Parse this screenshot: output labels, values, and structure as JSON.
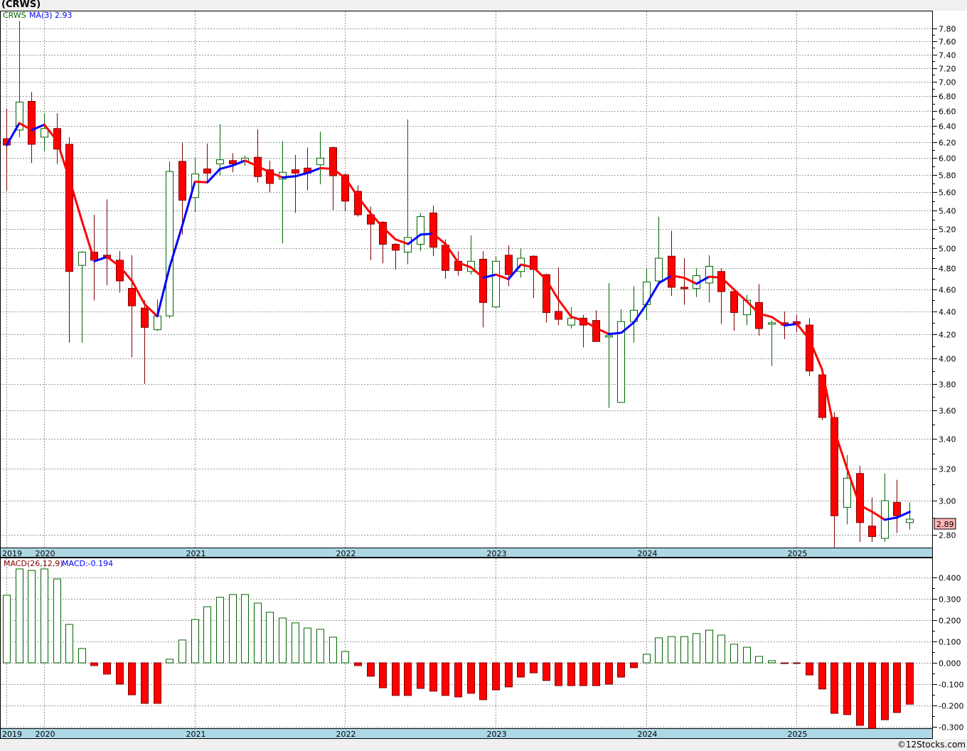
{
  "title": "(CRWS)",
  "copyright": "©12Stocks.com",
  "colors": {
    "up_border": "#006400",
    "down_fill": "#ff0000",
    "down_border": "#800000",
    "ma_up": "#0000ff",
    "ma_down": "#ff0000",
    "date_strip": "#add8e6",
    "last_price_box": "#ffb6b6"
  },
  "price_panel": {
    "legend_symbol": "CRWS",
    "legend_ma": "MA(3)",
    "legend_ma_value": "2.93",
    "last_price": "2.89",
    "scale": "log",
    "y_ticks": [
      "7.80",
      "7.60",
      "7.40",
      "7.20",
      "7.00",
      "6.80",
      "6.60",
      "6.40",
      "6.20",
      "6.00",
      "5.80",
      "5.60",
      "5.40",
      "5.20",
      "5.00",
      "4.80",
      "4.60",
      "4.40",
      "4.20",
      "4.00",
      "3.80",
      "3.60",
      "3.40",
      "3.20",
      "3.00",
      "2.80"
    ]
  },
  "macd_panel": {
    "legend_name": "MACD(26,12,9)",
    "legend_value": "MACD:-0.194",
    "y_ticks": [
      "0.400",
      "0.300",
      "0.200",
      "0.100",
      "0.000",
      "-0.100",
      "-0.200",
      "-0.300"
    ]
  },
  "year_labels": [
    {
      "label": "2019",
      "month": "2019-10"
    },
    {
      "label": "2020",
      "month": "2020-01"
    },
    {
      "label": "2021",
      "month": "2021-01"
    },
    {
      "label": "2022",
      "month": "2022-01"
    },
    {
      "label": "2023",
      "month": "2023-01"
    },
    {
      "label": "2024",
      "month": "2024-01"
    },
    {
      "label": "2025",
      "month": "2025-01"
    }
  ],
  "chart_data": {
    "type": "candlestick",
    "interval": "monthly",
    "grid": true,
    "months": [
      "2019-10",
      "2019-11",
      "2019-12",
      "2020-01",
      "2020-02",
      "2020-03",
      "2020-04",
      "2020-05",
      "2020-06",
      "2020-07",
      "2020-08",
      "2020-09",
      "2020-10",
      "2020-11",
      "2020-12",
      "2021-01",
      "2021-02",
      "2021-03",
      "2021-04",
      "2021-05",
      "2021-06",
      "2021-07",
      "2021-08",
      "2021-09",
      "2021-10",
      "2021-11",
      "2021-12",
      "2022-01",
      "2022-02",
      "2022-03",
      "2022-04",
      "2022-05",
      "2022-06",
      "2022-07",
      "2022-08",
      "2022-09",
      "2022-10",
      "2022-11",
      "2022-12",
      "2023-01",
      "2023-02",
      "2023-03",
      "2023-04",
      "2023-05",
      "2023-06",
      "2023-07",
      "2023-08",
      "2023-09",
      "2023-10",
      "2023-11",
      "2023-12",
      "2024-01",
      "2024-02",
      "2024-03",
      "2024-04",
      "2024-05",
      "2024-06",
      "2024-07",
      "2024-08",
      "2024-09",
      "2024-10",
      "2024-11",
      "2024-12",
      "2025-01",
      "2025-02",
      "2025-03",
      "2025-04",
      "2025-05",
      "2025-06",
      "2025-07",
      "2025-08",
      "2025-09",
      "2025-10"
    ],
    "ohlc": [
      [
        6.24,
        6.63,
        5.62,
        6.16
      ],
      [
        6.35,
        7.92,
        6.26,
        6.72
      ],
      [
        6.73,
        6.86,
        5.94,
        6.17
      ],
      [
        6.26,
        6.57,
        6.09,
        6.37
      ],
      [
        6.37,
        6.57,
        5.93,
        6.11
      ],
      [
        6.17,
        6.26,
        4.13,
        4.77
      ],
      [
        4.83,
        4.97,
        4.13,
        4.96
      ],
      [
        4.96,
        5.35,
        4.5,
        4.88
      ],
      [
        4.93,
        5.52,
        4.64,
        4.9
      ],
      [
        4.88,
        4.97,
        4.57,
        4.68
      ],
      [
        4.61,
        4.93,
        4.01,
        4.45
      ],
      [
        4.43,
        4.5,
        3.8,
        4.26
      ],
      [
        4.24,
        4.51,
        4.23,
        4.36
      ],
      [
        4.36,
        5.96,
        4.34,
        5.84
      ],
      [
        5.96,
        6.19,
        5.14,
        5.51
      ],
      [
        5.54,
        6.0,
        5.38,
        5.81
      ],
      [
        5.87,
        6.18,
        5.7,
        5.82
      ],
      [
        5.93,
        6.43,
        5.79,
        5.98
      ],
      [
        5.97,
        6.06,
        5.83,
        5.93
      ],
      [
        5.96,
        6.03,
        5.91,
        6.0
      ],
      [
        6.01,
        6.36,
        5.71,
        5.78
      ],
      [
        5.86,
        5.97,
        5.6,
        5.7
      ],
      [
        5.75,
        6.21,
        5.05,
        5.83
      ],
      [
        5.86,
        6.04,
        5.37,
        5.82
      ],
      [
        5.88,
        6.13,
        5.62,
        5.82
      ],
      [
        5.92,
        6.33,
        5.69,
        6.0
      ],
      [
        6.13,
        6.14,
        5.4,
        5.79
      ],
      [
        5.8,
        5.82,
        5.39,
        5.5
      ],
      [
        5.61,
        5.68,
        5.33,
        5.35
      ],
      [
        5.35,
        5.44,
        4.88,
        5.25
      ],
      [
        5.27,
        5.28,
        4.85,
        5.04
      ],
      [
        5.04,
        5.05,
        4.79,
        4.98
      ],
      [
        4.96,
        6.49,
        4.84,
        5.11
      ],
      [
        5.04,
        5.37,
        4.97,
        5.33
      ],
      [
        5.37,
        5.45,
        4.92,
        5.01
      ],
      [
        5.03,
        5.09,
        4.7,
        4.78
      ],
      [
        4.87,
        4.97,
        4.73,
        4.78
      ],
      [
        4.77,
        5.13,
        4.74,
        4.87
      ],
      [
        4.89,
        4.97,
        4.26,
        4.48
      ],
      [
        4.44,
        4.92,
        4.43,
        4.87
      ],
      [
        4.93,
        5.03,
        4.63,
        4.74
      ],
      [
        4.77,
        5.0,
        4.71,
        4.9
      ],
      [
        4.92,
        4.93,
        4.52,
        4.79
      ],
      [
        4.74,
        4.75,
        4.3,
        4.39
      ],
      [
        4.4,
        4.81,
        4.28,
        4.33
      ],
      [
        4.28,
        4.44,
        4.25,
        4.34
      ],
      [
        4.34,
        4.37,
        4.09,
        4.28
      ],
      [
        4.32,
        4.41,
        4.14,
        4.14
      ],
      [
        4.19,
        4.66,
        3.62,
        4.19
      ],
      [
        3.66,
        4.42,
        3.66,
        4.31
      ],
      [
        4.31,
        4.63,
        4.13,
        4.41
      ],
      [
        4.46,
        4.8,
        4.32,
        4.67
      ],
      [
        4.68,
        5.33,
        4.67,
        4.9
      ],
      [
        4.92,
        5.18,
        4.54,
        4.62
      ],
      [
        4.62,
        4.9,
        4.46,
        4.61
      ],
      [
        4.61,
        4.8,
        4.53,
        4.73
      ],
      [
        4.66,
        4.93,
        4.48,
        4.82
      ],
      [
        4.77,
        4.8,
        4.29,
        4.58
      ],
      [
        4.58,
        4.59,
        4.23,
        4.39
      ],
      [
        4.37,
        4.55,
        4.28,
        4.5
      ],
      [
        4.48,
        4.65,
        4.19,
        4.25
      ],
      [
        4.29,
        4.32,
        3.94,
        4.3
      ],
      [
        4.3,
        4.4,
        4.16,
        4.28
      ],
      [
        4.31,
        4.37,
        4.22,
        4.29
      ],
      [
        4.28,
        4.34,
        3.86,
        3.9
      ],
      [
        3.87,
        3.88,
        3.53,
        3.55
      ],
      [
        3.55,
        3.59,
        2.73,
        2.91
      ],
      [
        2.96,
        3.29,
        2.86,
        3.14
      ],
      [
        3.17,
        3.22,
        2.76,
        2.87
      ],
      [
        2.85,
        3.02,
        2.76,
        2.79
      ],
      [
        2.78,
        3.17,
        2.76,
        3.0
      ],
      [
        2.99,
        3.13,
        2.81,
        2.91
      ],
      [
        2.87,
        2.99,
        2.83,
        2.89
      ]
    ],
    "ma_period": 3,
    "price_range": [
      2.7,
      8.1
    ],
    "macd": [
      0.317,
      0.44,
      0.433,
      0.44,
      0.393,
      0.18,
      0.067,
      -0.013,
      -0.053,
      -0.1,
      -0.15,
      -0.19,
      -0.19,
      0.017,
      0.107,
      0.203,
      0.263,
      0.307,
      0.32,
      0.32,
      0.28,
      0.237,
      0.21,
      0.187,
      0.163,
      0.157,
      0.12,
      0.053,
      -0.013,
      -0.063,
      -0.117,
      -0.153,
      -0.153,
      -0.12,
      -0.133,
      -0.153,
      -0.16,
      -0.143,
      -0.173,
      -0.127,
      -0.113,
      -0.067,
      -0.047,
      -0.083,
      -0.107,
      -0.107,
      -0.107,
      -0.107,
      -0.1,
      -0.067,
      -0.023,
      0.04,
      0.117,
      0.123,
      0.123,
      0.137,
      0.153,
      0.13,
      0.087,
      0.073,
      0.03,
      0.01,
      -0.002,
      -0.003,
      -0.057,
      -0.123,
      -0.237,
      -0.243,
      -0.293,
      -0.307,
      -0.267,
      -0.233,
      -0.194
    ],
    "macd_range": [
      -0.33,
      0.48
    ]
  }
}
